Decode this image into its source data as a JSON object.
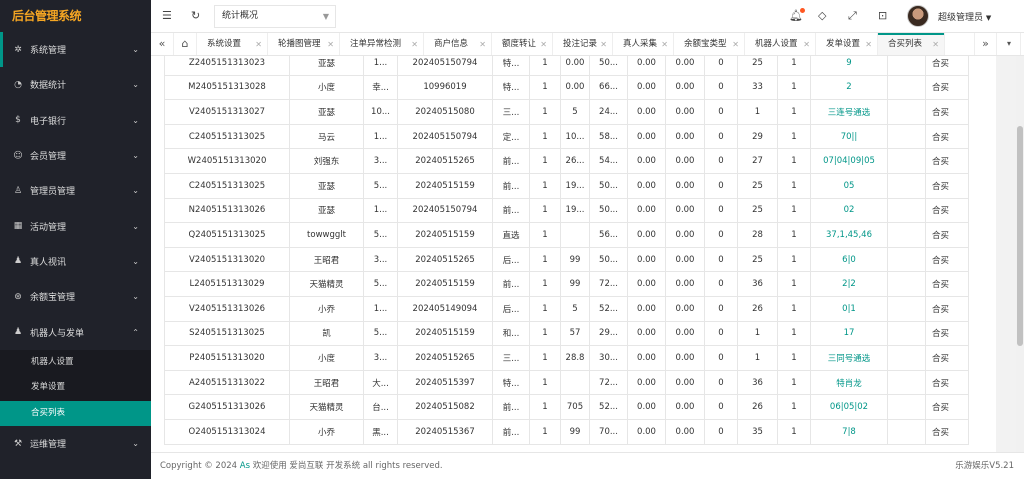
{
  "app": {
    "logo": "后台管理系统"
  },
  "sidebar": {
    "items": [
      {
        "label": "系统管理",
        "icon": "gear-icon",
        "glyph": "✲"
      },
      {
        "label": "数据统计",
        "icon": "dashboard-icon",
        "glyph": "◔"
      },
      {
        "label": "电子银行",
        "icon": "dollar-icon",
        "glyph": "$"
      },
      {
        "label": "会员管理",
        "icon": "users-icon",
        "glyph": "☺"
      },
      {
        "label": "管理员管理",
        "icon": "user-icon",
        "glyph": "♙"
      },
      {
        "label": "活动管理",
        "icon": "gift-icon",
        "glyph": "▦"
      },
      {
        "label": "真人视讯",
        "icon": "video-icon",
        "glyph": "♟"
      },
      {
        "label": "余额宝管理",
        "icon": "wallet-icon",
        "glyph": "⊛"
      },
      {
        "label": "机器人与发单",
        "icon": "robot-icon",
        "glyph": "♟"
      }
    ],
    "sub_items": [
      "机器人设置",
      "发单设置",
      "合买列表"
    ],
    "last_item": {
      "label": "运维管理",
      "icon": "tools-icon",
      "glyph": "⚒"
    }
  },
  "topbar": {
    "select_value": "统计概况",
    "user_name": "超级管理员"
  },
  "tabs": [
    "系统设置",
    "轮播图管理",
    "注单异常检测",
    "商户信息",
    "额度转让",
    "投注记录",
    "真人采集",
    "余额宝类型",
    "机器人设置",
    "发单设置",
    "合买列表"
  ],
  "table": {
    "rows": [
      [
        "Z2405151313023",
        "亚瑟",
        "1...",
        "202405150794",
        "特...",
        "1",
        "0.00",
        "50...",
        "0.00",
        "0.00",
        "0",
        "25",
        "1",
        "9",
        "",
        "合买"
      ],
      [
        "M2405151313028",
        "小度",
        "幸...",
        "10996019",
        "特...",
        "1",
        "0.00",
        "66...",
        "0.00",
        "0.00",
        "0",
        "33",
        "1",
        "2",
        "",
        "合买"
      ],
      [
        "V2405151313027",
        "亚瑟",
        "10...",
        "20240515080",
        "三...",
        "1",
        "5",
        "24...",
        "0.00",
        "0.00",
        "0",
        "1",
        "1",
        "三连号通选",
        "",
        "合买"
      ],
      [
        "C2405151313025",
        "马云",
        "1...",
        "202405150794",
        "定...",
        "1",
        "10...",
        "58...",
        "0.00",
        "0.00",
        "0",
        "29",
        "1",
        "70||",
        "",
        "合买"
      ],
      [
        "W2405151313020",
        "刘强东",
        "3...",
        "20240515265",
        "前...",
        "1",
        "26...",
        "54...",
        "0.00",
        "0.00",
        "0",
        "27",
        "1",
        "07|04|09|05",
        "",
        "合买"
      ],
      [
        "C2405151313025",
        "亚瑟",
        "5...",
        "20240515159",
        "前...",
        "1",
        "19...",
        "50...",
        "0.00",
        "0.00",
        "0",
        "25",
        "1",
        "05",
        "",
        "合买"
      ],
      [
        "N2405151313026",
        "亚瑟",
        "1...",
        "202405150794",
        "前...",
        "1",
        "19...",
        "50...",
        "0.00",
        "0.00",
        "0",
        "25",
        "1",
        "02",
        "",
        "合买"
      ],
      [
        "Q2405151313025",
        "towwgglt",
        "5...",
        "20240515159",
        "直选",
        "1",
        "",
        "56...",
        "0.00",
        "0.00",
        "0",
        "28",
        "1",
        "37,1,45,46",
        "",
        "合买"
      ],
      [
        "V2405151313020",
        "王昭君",
        "3...",
        "20240515265",
        "后...",
        "1",
        "99",
        "50...",
        "0.00",
        "0.00",
        "0",
        "25",
        "1",
        "6|0",
        "",
        "合买"
      ],
      [
        "L2405151313029",
        "天猫精灵",
        "5...",
        "20240515159",
        "前...",
        "1",
        "99",
        "72...",
        "0.00",
        "0.00",
        "0",
        "36",
        "1",
        "2|2",
        "",
        "合买"
      ],
      [
        "V2405151313026",
        "小乔",
        "1...",
        "202405149094",
        "后...",
        "1",
        "5",
        "52...",
        "0.00",
        "0.00",
        "0",
        "26",
        "1",
        "0|1",
        "",
        "合买"
      ],
      [
        "S2405151313025",
        "凯",
        "5...",
        "20240515159",
        "和...",
        "1",
        "57",
        "29...",
        "0.00",
        "0.00",
        "0",
        "1",
        "1",
        "17",
        "",
        "合买"
      ],
      [
        "P2405151313020",
        "小度",
        "3...",
        "20240515265",
        "三...",
        "1",
        "28.8",
        "30...",
        "0.00",
        "0.00",
        "0",
        "1",
        "1",
        "三同号通选",
        "",
        "合买"
      ],
      [
        "A2405151313022",
        "王昭君",
        "大...",
        "20240515397",
        "特...",
        "1",
        "",
        "72...",
        "0.00",
        "0.00",
        "0",
        "36",
        "1",
        "特肖龙",
        "",
        "合买"
      ],
      [
        "G2405151313026",
        "天猫精灵",
        "台...",
        "20240515082",
        "前...",
        "1",
        "705",
        "52...",
        "0.00",
        "0.00",
        "0",
        "26",
        "1",
        "06|05|02",
        "",
        "合买"
      ],
      [
        "O2405151313024",
        "小乔",
        "黑...",
        "20240515367",
        "前...",
        "1",
        "99",
        "70...",
        "0.00",
        "0.00",
        "0",
        "35",
        "1",
        "7|8",
        "",
        "合买"
      ]
    ]
  },
  "footer": {
    "copy": "Copyright © 2024 ",
    "brand": "As",
    "rest": " 欢迎使用 爱尚互联 开发系统 all rights reserved.",
    "version": "乐游娱乐V5.21"
  }
}
